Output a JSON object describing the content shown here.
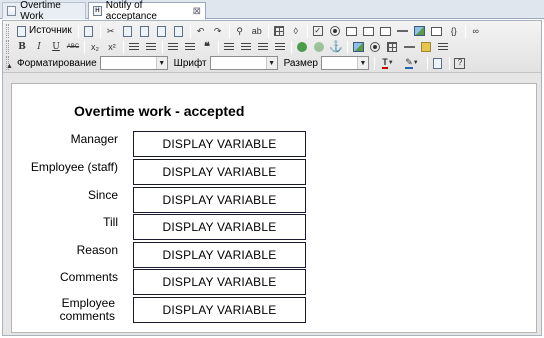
{
  "tabs": [
    {
      "label": "Overtime Work",
      "icon": "document-icon",
      "active": false
    },
    {
      "label": "Notify of acceptance",
      "icon": "html-icon",
      "active": true,
      "close": "⊠"
    }
  ],
  "toolbar": {
    "source_label": "Источник",
    "format_label": "Форматирование",
    "font_label": "Шрифт",
    "size_label": "Размер",
    "format_value": "",
    "font_value": "",
    "size_value": ""
  },
  "form": {
    "title": "Overtime work - accepted",
    "fields": [
      {
        "label": "Manager",
        "value": "DISPLAY VARIABLE"
      },
      {
        "label": "Employee (staff)",
        "value": "DISPLAY VARIABLE"
      },
      {
        "label": "Since",
        "value": "DISPLAY VARIABLE"
      },
      {
        "label": "Till",
        "value": "DISPLAY VARIABLE"
      },
      {
        "label": "Reason",
        "value": "DISPLAY VARIABLE"
      },
      {
        "label": "Comments",
        "value": "DISPLAY VARIABLE"
      },
      {
        "label": "Employee comments",
        "value": "DISPLAY VARIABLE"
      }
    ]
  }
}
